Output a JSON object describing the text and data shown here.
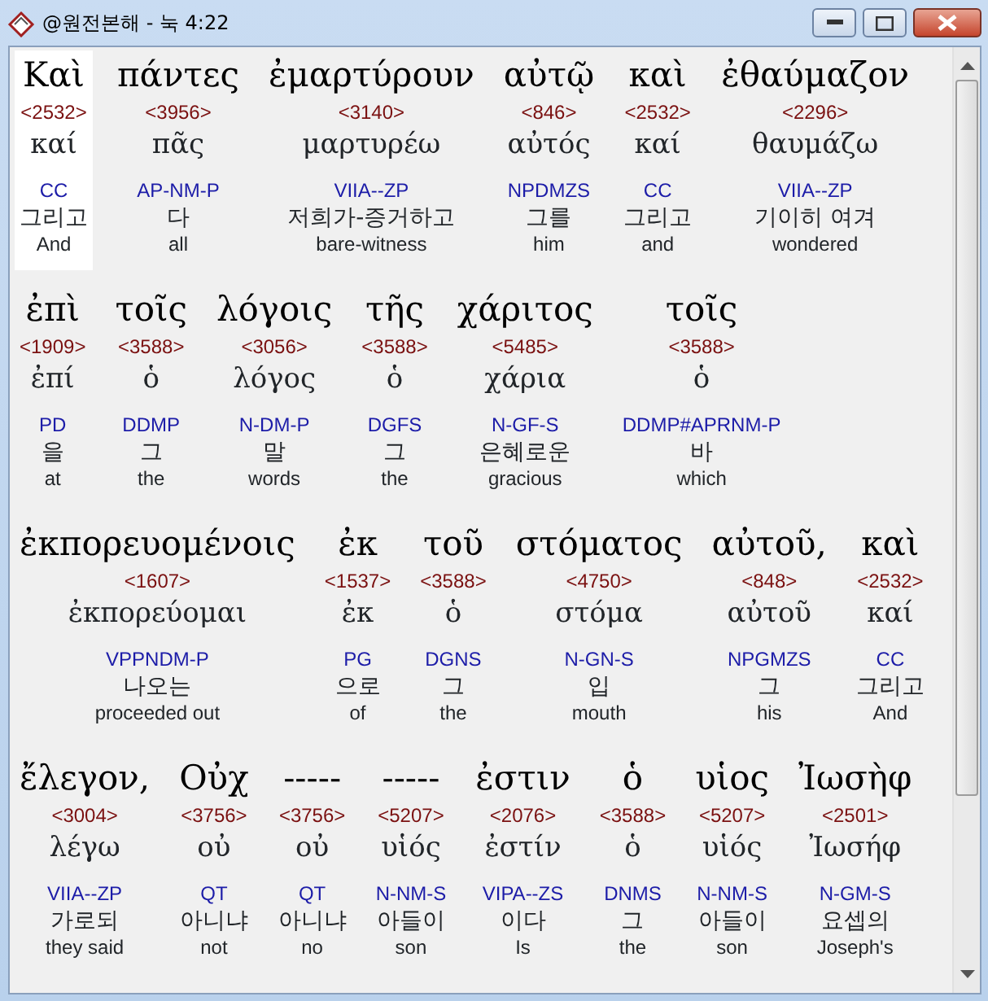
{
  "window": {
    "title": "@원전본해 - 눅 4:22"
  },
  "lines": [
    {
      "words": [
        {
          "greek": "Καὶ",
          "strong": "<2532>",
          "lemma": "καί",
          "parsing": "CC",
          "korean": "그리고",
          "english": "And",
          "selected": true
        },
        {
          "greek": "πάντες",
          "strong": "<3956>",
          "lemma": "πᾶς",
          "parsing": "AP-NM-P",
          "korean": "다",
          "english": "all",
          "selected": false
        },
        {
          "greek": "ἐμαρτύρουν",
          "strong": "<3140>",
          "lemma": "μαρτυρέω",
          "parsing": "VIIA--ZP",
          "korean": "저희가-증거하고",
          "english": "bare-witness",
          "selected": false
        },
        {
          "greek": "αὐτῷ",
          "strong": "<846>",
          "lemma": "αὐτός",
          "parsing": "NPDMZS",
          "korean": "그를",
          "english": "him",
          "selected": false
        },
        {
          "greek": "καὶ",
          "strong": "<2532>",
          "lemma": "καί",
          "parsing": "CC",
          "korean": "그리고",
          "english": "and",
          "selected": false
        },
        {
          "greek": "ἐθαύμαζον",
          "strong": "<2296>",
          "lemma": "θαυμάζω",
          "parsing": "VIIA--ZP",
          "korean": "기이히 여겨",
          "english": "wondered",
          "selected": false
        }
      ]
    },
    {
      "words": [
        {
          "greek": "ἐπὶ",
          "strong": "<1909>",
          "lemma": "ἐπί",
          "parsing": "PD",
          "korean": "을",
          "english": "at",
          "selected": false
        },
        {
          "greek": "τοῖς",
          "strong": "<3588>",
          "lemma": "ὁ",
          "parsing": "DDMP",
          "korean": "그",
          "english": "the",
          "selected": false
        },
        {
          "greek": "λόγοις",
          "strong": "<3056>",
          "lemma": "λόγος",
          "parsing": "N-DM-P",
          "korean": "말",
          "english": "words",
          "selected": false
        },
        {
          "greek": "τῆς",
          "strong": "<3588>",
          "lemma": "ὁ",
          "parsing": "DGFS",
          "korean": "그",
          "english": "the",
          "selected": false
        },
        {
          "greek": "χάριτος",
          "strong": "<5485>",
          "lemma": "χάρια",
          "parsing": "N-GF-S",
          "korean": "은혜로운",
          "english": "gracious",
          "selected": false
        },
        {
          "greek": "τοῖς",
          "strong": "<3588>",
          "lemma": "ὁ",
          "parsing": "DDMP#APRNM-P",
          "korean": "바",
          "english": "which",
          "selected": false
        }
      ]
    },
    {
      "words": [
        {
          "greek": "ἐκπορευομένοις",
          "strong": "<1607>",
          "lemma": "ἐκπορεύομαι",
          "parsing": "VPPNDM-P",
          "korean": "나오는",
          "english": "proceeded out",
          "selected": false
        },
        {
          "greek": "ἐκ",
          "strong": "<1537>",
          "lemma": "ἐκ",
          "parsing": "PG",
          "korean": "으로",
          "english": "of",
          "selected": false
        },
        {
          "greek": "τοῦ",
          "strong": "<3588>",
          "lemma": "ὁ",
          "parsing": "DGNS",
          "korean": "그",
          "english": "the",
          "selected": false
        },
        {
          "greek": "στόματος",
          "strong": "<4750>",
          "lemma": "στόμα",
          "parsing": "N-GN-S",
          "korean": "입",
          "english": "mouth",
          "selected": false
        },
        {
          "greek": "αὐτοῦ,",
          "strong": "<848>",
          "lemma": "αὐτοῦ",
          "parsing": "NPGMZS",
          "korean": "그",
          "english": "his",
          "selected": false
        },
        {
          "greek": "καὶ",
          "strong": "<2532>",
          "lemma": "καί",
          "parsing": "CC",
          "korean": "그리고",
          "english": "And",
          "selected": false
        }
      ]
    },
    {
      "words": [
        {
          "greek": "ἔλεγον,",
          "strong": "<3004>",
          "lemma": "λέγω",
          "parsing": "VIIA--ZP",
          "korean": "가로되",
          "english": "they said",
          "selected": false
        },
        {
          "greek": "Οὐχ",
          "strong": "<3756>",
          "lemma": "οὐ",
          "parsing": "QT",
          "korean": "아니냐",
          "english": "not",
          "selected": false
        },
        {
          "greek": "-----",
          "strong": "<3756>",
          "lemma": "οὐ",
          "parsing": "QT",
          "korean": "아니냐",
          "english": "no",
          "selected": false
        },
        {
          "greek": "-----",
          "strong": "<5207>",
          "lemma": "υἱός",
          "parsing": "N-NM-S",
          "korean": "아들이",
          "english": "son",
          "selected": false
        },
        {
          "greek": "ἐστιν",
          "strong": "<2076>",
          "lemma": "ἐστίν",
          "parsing": "VIPA--ZS",
          "korean": "이다",
          "english": "Is",
          "selected": false
        },
        {
          "greek": "ὁ",
          "strong": "<3588>",
          "lemma": "ὁ",
          "parsing": "DNMS",
          "korean": "그",
          "english": "the",
          "selected": false
        },
        {
          "greek": "υἱος",
          "strong": "<5207>",
          "lemma": "υἱός",
          "parsing": "N-NM-S",
          "korean": "아들이",
          "english": "son",
          "selected": false
        },
        {
          "greek": "Ἰωσὴφ",
          "strong": "<2501>",
          "lemma": "Ἰωσήφ",
          "parsing": "N-GM-S",
          "korean": "요셉의",
          "english": "Joseph's",
          "selected": false
        }
      ]
    }
  ]
}
